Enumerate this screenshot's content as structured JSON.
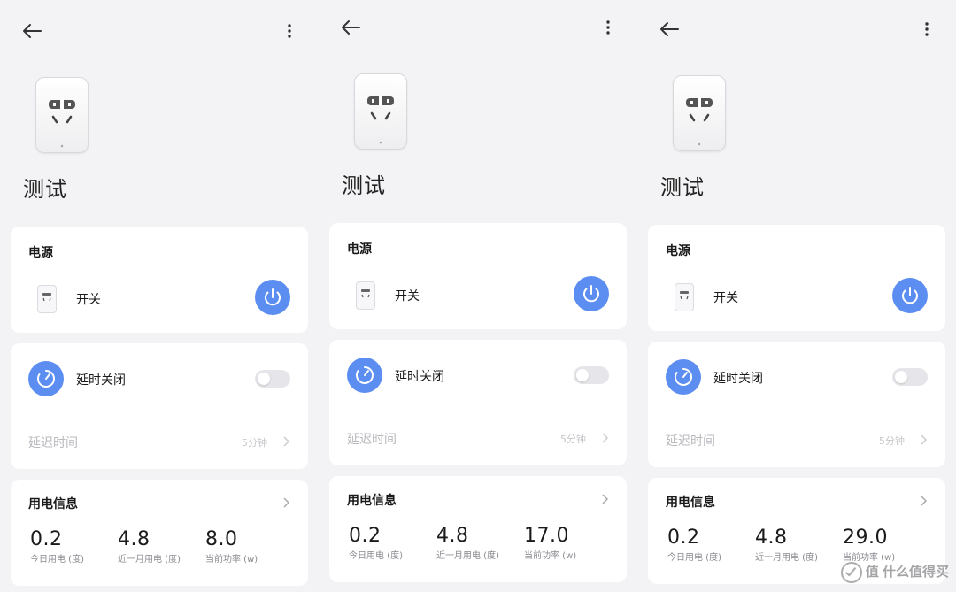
{
  "screens": [
    {
      "device_name": "测试",
      "power_section_title": "电源",
      "switch_label": "开关",
      "timer_label": "延时关闭",
      "delay_label": "延迟时间",
      "delay_value": "5分钟",
      "energy_title": "用电信息",
      "today_value": "0.2",
      "today_label": "今日用电 (度)",
      "month_value": "4.8",
      "month_label": "近一月用电 (度)",
      "power_value": "8.0",
      "power_label": "当前功率 (w)"
    },
    {
      "device_name": "测试",
      "power_section_title": "电源",
      "switch_label": "开关",
      "timer_label": "延时关闭",
      "delay_label": "延迟时间",
      "delay_value": "5分钟",
      "energy_title": "用电信息",
      "today_value": "0.2",
      "today_label": "今日用电 (度)",
      "month_value": "4.8",
      "month_label": "近一月用电 (度)",
      "power_value": "17.0",
      "power_label": "当前功率 (w)"
    },
    {
      "device_name": "测试",
      "power_section_title": "电源",
      "switch_label": "开关",
      "timer_label": "延时关闭",
      "delay_label": "延迟时间",
      "delay_value": "5分钟",
      "energy_title": "用电信息",
      "today_value": "0.2",
      "today_label": "今日用电 (度)",
      "month_value": "4.8",
      "month_label": "近一月用电 (度)",
      "power_value": "29.0",
      "power_label": "当前功率 (w)"
    }
  ],
  "watermark": "值 什么值得买",
  "colors": {
    "accent": "#5b8ef0",
    "background": "#f3f3f5",
    "card": "#ffffff",
    "toggle_off": "#e6e6ea"
  },
  "icons": [
    "back-arrow-icon",
    "more-vertical-icon",
    "smart-plug-icon",
    "power-icon",
    "timer-icon",
    "chevron-right-icon"
  ]
}
